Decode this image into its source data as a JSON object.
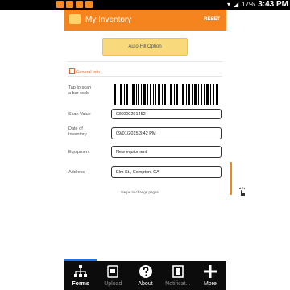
{
  "status_bar": {
    "time": "3:43 PM",
    "battery": "17%"
  },
  "app_bar": {
    "title": "My Inventory",
    "reset_label": "RESET",
    "accent": "#f5841f"
  },
  "autofill": {
    "label": "Auto-Fill Option"
  },
  "section": {
    "title": "General info"
  },
  "barcode": {
    "label_line1": "Tap to scan",
    "label_line2": "a bar code"
  },
  "fields": {
    "scan_value": {
      "label": "Scan Value",
      "value": "036000291452"
    },
    "date": {
      "label_line1": "Date of",
      "label_line2": "Inventory",
      "value": "09/01/2015 3:42 PM"
    },
    "equipment": {
      "label": "Equipment",
      "value": "New equipment"
    },
    "address": {
      "label": "Address",
      "value": "Elm St., Compton, CA"
    }
  },
  "swipe_hint": "Swipe to change pages",
  "nav": {
    "items": [
      {
        "label": "Forms",
        "icon": "hierarchy-icon"
      },
      {
        "label": "Upload",
        "icon": "upload-icon"
      },
      {
        "label": "About",
        "icon": "help-icon"
      },
      {
        "label": "Notificat...",
        "icon": "notification-icon"
      },
      {
        "label": "More",
        "icon": "plus-icon"
      }
    ]
  }
}
